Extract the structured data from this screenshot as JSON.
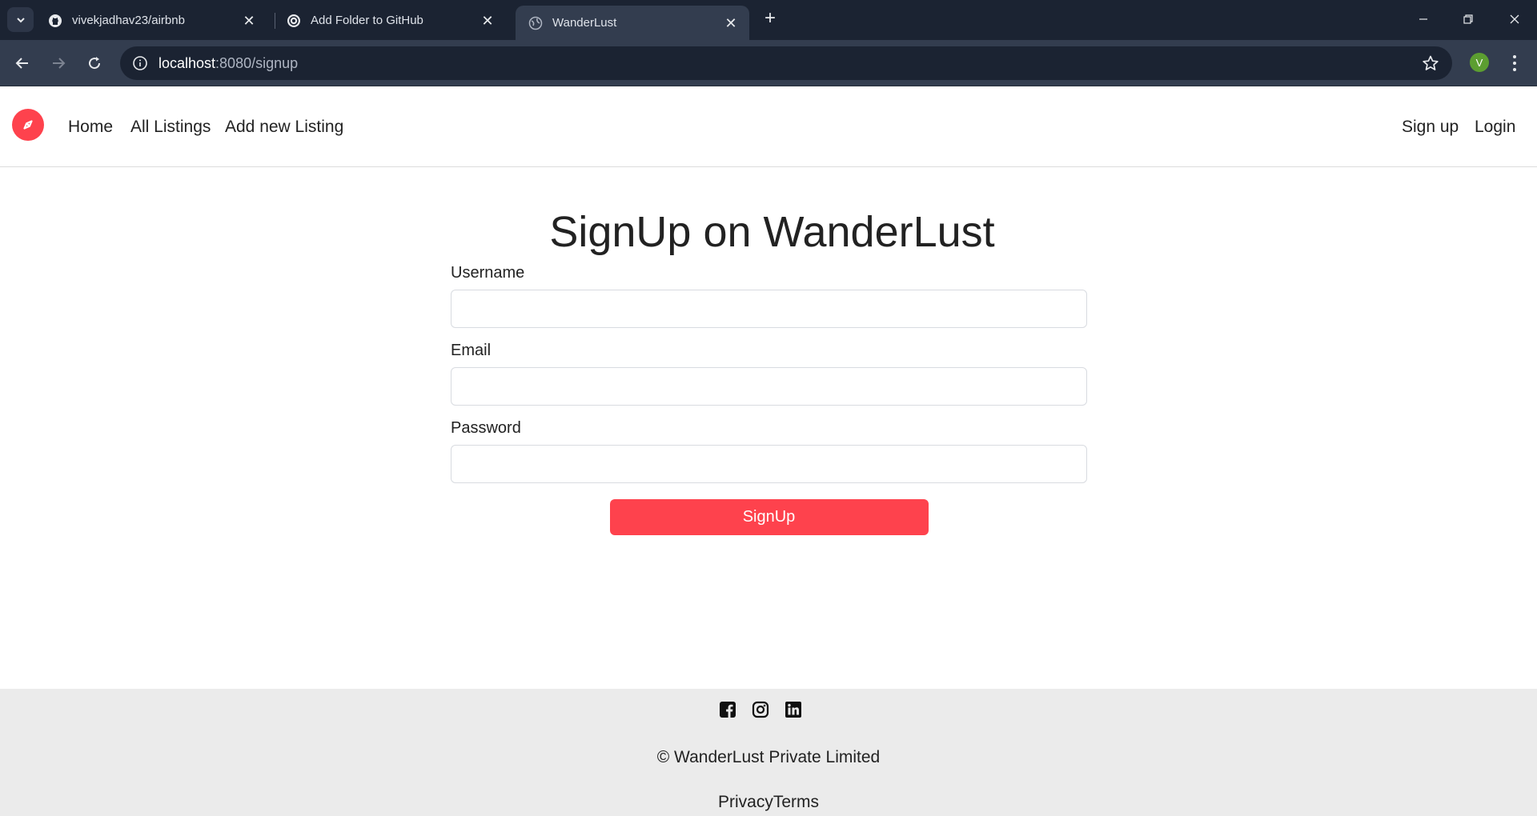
{
  "browser": {
    "tabs": [
      {
        "title": "vivekjadhav23/airbnb",
        "icon": "github-icon"
      },
      {
        "title": "Add Folder to GitHub",
        "icon": "openai-icon"
      },
      {
        "title": "WanderLust",
        "icon": "globe-icon",
        "active": true
      }
    ],
    "url_host": "localhost",
    "url_path": ":8080/signup",
    "profile_initial": "V"
  },
  "navbar": {
    "links": [
      "Home",
      "All Listings",
      "Add new Listing"
    ],
    "right_links": [
      "Sign up",
      "Login"
    ],
    "brand_icon": "compass-icon"
  },
  "form": {
    "heading": "SignUp on WanderLust",
    "username_label": "Username",
    "username_value": "",
    "email_label": "Email",
    "email_value": "",
    "password_label": "Password",
    "password_value": "",
    "submit_label": "SignUp"
  },
  "footer": {
    "socials": [
      "facebook-icon",
      "instagram-icon",
      "linkedin-icon"
    ],
    "copyright": "© WanderLust Private Limited",
    "legal": "PrivacyTerms"
  },
  "colors": {
    "brand": "#fe424d",
    "chrome_dark": "#1b2332",
    "chrome_mid": "#333d4f",
    "footer_bg": "#ebebeb"
  }
}
